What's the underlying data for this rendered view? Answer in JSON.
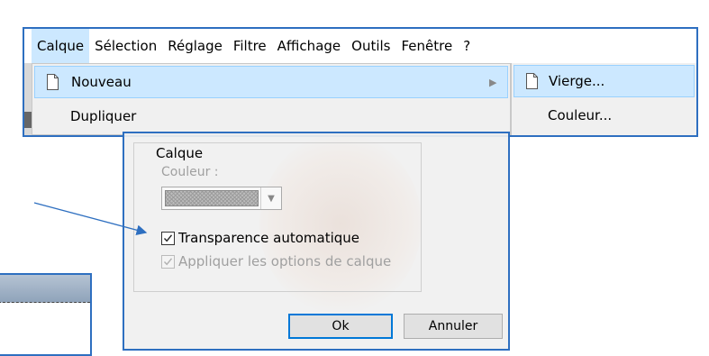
{
  "menubar": {
    "items": [
      "Calque",
      "Sélection",
      "Réglage",
      "Filtre",
      "Affichage",
      "Outils",
      "Fenêtre",
      "?"
    ]
  },
  "dropdown": {
    "items": [
      {
        "label": "Nouveau",
        "icon": "page-icon",
        "has_submenu": true
      },
      {
        "label": "Dupliquer",
        "icon": "",
        "has_submenu": false
      }
    ]
  },
  "submenu": {
    "items": [
      {
        "label": "Vierge...",
        "icon": "page-icon"
      },
      {
        "label": "Couleur...",
        "icon": ""
      }
    ]
  },
  "dialog": {
    "group_title": "Calque",
    "color_label": "Couleur :",
    "transparency_label": "Transparence automatique",
    "transparency_checked": true,
    "apply_options_label": "Appliquer les options de calque",
    "apply_options_checked": true,
    "ok_label": "Ok",
    "cancel_label": "Annuler"
  },
  "colors": {
    "highlight": "#cce8ff",
    "panel_border": "#2e6fc0",
    "arrow": "#2e6fc0"
  }
}
